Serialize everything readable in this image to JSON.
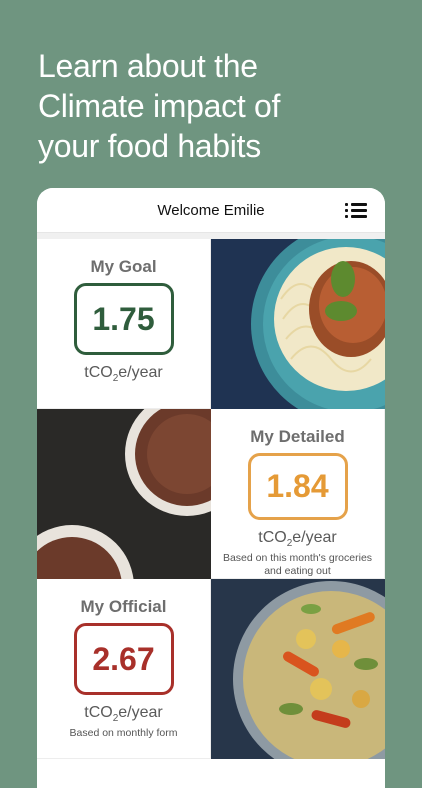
{
  "headline": {
    "line1": "Learn about the",
    "line2": "Climate impact of",
    "line3": "your food habits"
  },
  "app": {
    "title": "Welcome Emilie",
    "menu_icon": "list-menu-icon"
  },
  "cards": {
    "goal": {
      "label": "My Goal",
      "value": "1.75",
      "unit_main": "tCO",
      "unit_sub": "2",
      "unit_tail": "e/year",
      "color": "#2f5d3c"
    },
    "detailed": {
      "label": "My Detailed",
      "value": "1.84",
      "unit_main": "tCO",
      "unit_sub": "2",
      "unit_tail": "e/year",
      "note": "Based on this month's groceries and eating out",
      "color": "#e59a36"
    },
    "official": {
      "label": "My Official",
      "value": "2.67",
      "unit_main": "tCO",
      "unit_sub": "2",
      "unit_tail": "e/year",
      "note": "Based on monthly form",
      "color": "#a8302a"
    }
  },
  "images": [
    "pasta-dish-photo",
    "chocolate-mousse-photo",
    "vegetable-curry-photo"
  ]
}
